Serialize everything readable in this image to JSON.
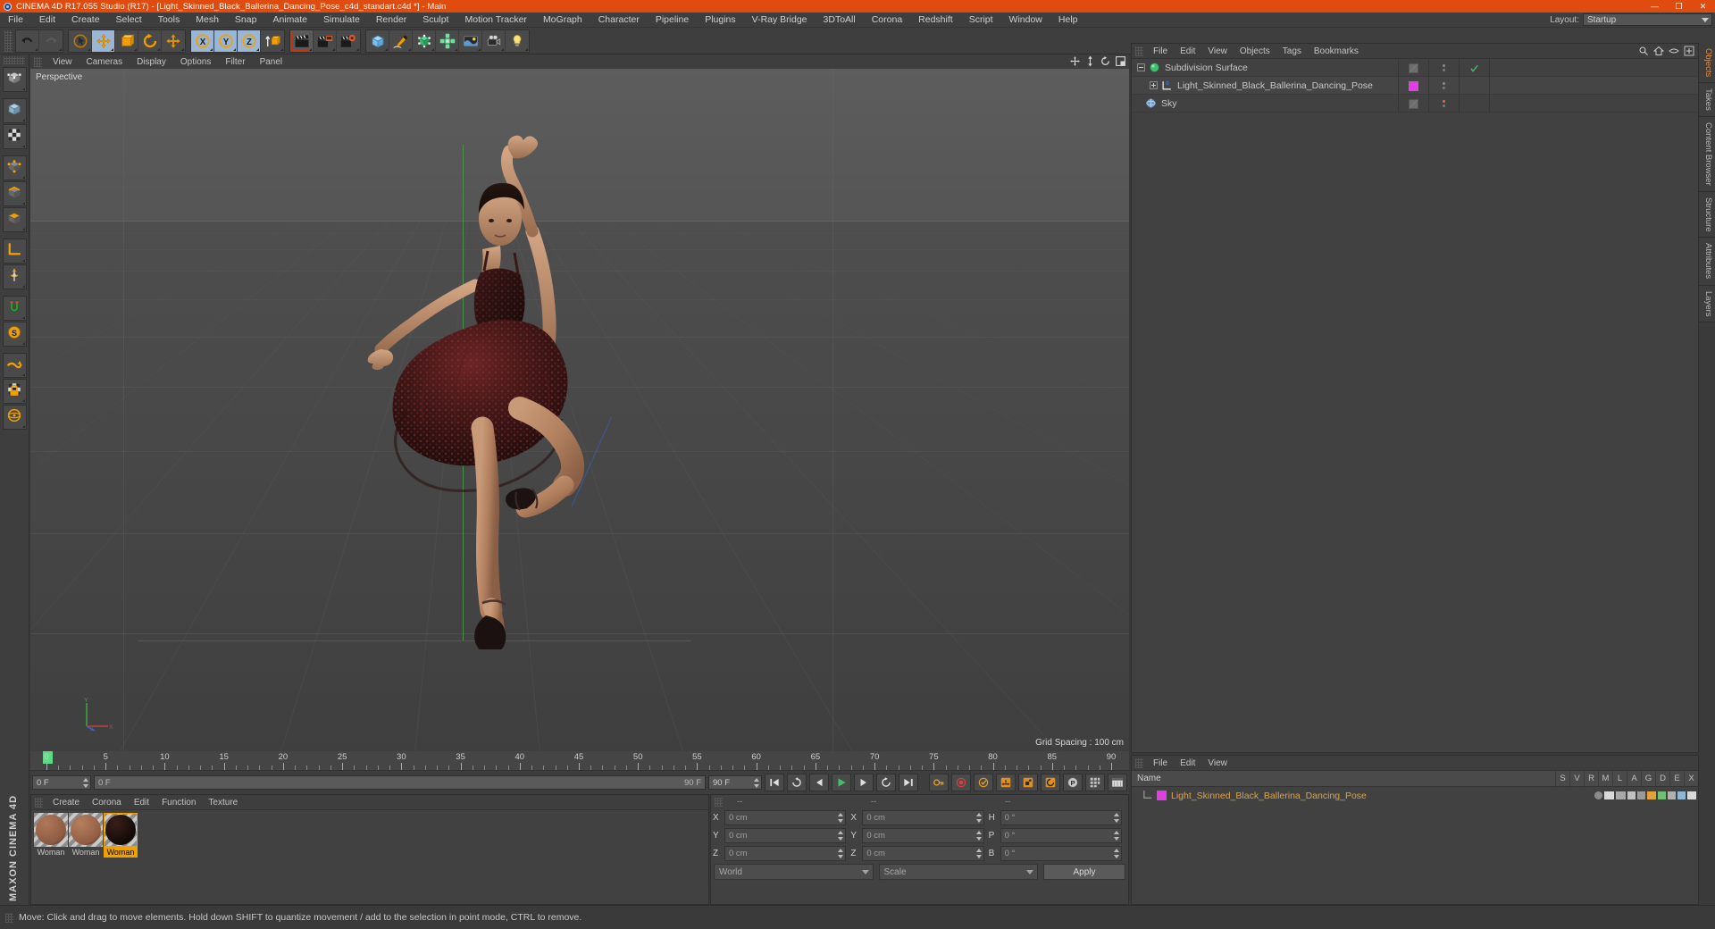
{
  "titlebar": {
    "title": "CINEMA 4D R17.055 Studio (R17) - [Light_Skinned_Black_Ballerina_Dancing_Pose_c4d_standart.c4d *] - Main",
    "minimize": "—",
    "maximize": "❐",
    "close": "✕",
    "accent": "#e04b10"
  },
  "menubar": {
    "items": [
      "File",
      "Edit",
      "Create",
      "Select",
      "Tools",
      "Mesh",
      "Snap",
      "Animate",
      "Simulate",
      "Render",
      "Sculpt",
      "Motion Tracker",
      "MoGraph",
      "Character",
      "Pipeline",
      "Plugins",
      "V-Ray Bridge",
      "3DToAll",
      "Corona",
      "Redshift",
      "Script",
      "Window",
      "Help"
    ],
    "layout_label": "Layout:",
    "layout_value": "Startup"
  },
  "toolbar": {
    "groups": [
      {
        "name": "history",
        "buttons": [
          {
            "name": "undo-button",
            "icon": "undo-icon",
            "state": "normal"
          },
          {
            "name": "redo-button",
            "icon": "redo-icon",
            "state": "disabled"
          }
        ]
      },
      {
        "name": "transform",
        "buttons": [
          {
            "name": "live-selection-tool",
            "icon": "cursor-select-icon",
            "state": "normal"
          },
          {
            "name": "move-tool",
            "icon": "move-arrows-icon",
            "state": "active"
          },
          {
            "name": "scale-tool",
            "icon": "scale-box-icon",
            "state": "normal"
          },
          {
            "name": "rotate-tool",
            "icon": "rotate-circle-icon",
            "state": "normal"
          },
          {
            "name": "free-move-tool",
            "icon": "move-arrows-icon",
            "state": "normal"
          }
        ]
      },
      {
        "name": "axis-lock",
        "buttons": [
          {
            "name": "lock-x-axis",
            "icon": "x-axis-icon",
            "state": "active"
          },
          {
            "name": "lock-y-axis",
            "icon": "y-axis-icon",
            "state": "active"
          },
          {
            "name": "lock-z-axis",
            "icon": "z-axis-icon",
            "state": "active"
          },
          {
            "name": "world-object-coordinates",
            "icon": "world-axis-icon",
            "state": "normal"
          }
        ]
      },
      {
        "name": "render",
        "buttons": [
          {
            "name": "render-view-button",
            "icon": "clapperboard-icon",
            "state": "selected"
          },
          {
            "name": "render-to-picture-viewer-button",
            "icon": "clapperboard-viewer-icon",
            "state": "normal"
          },
          {
            "name": "edit-render-settings-button",
            "icon": "clapperboard-gear-icon",
            "state": "normal"
          }
        ]
      },
      {
        "name": "create",
        "buttons": [
          {
            "name": "add-primitive-cube-button",
            "icon": "cube-icon",
            "state": "normal"
          },
          {
            "name": "add-spline-pen-button",
            "icon": "pen-spline-icon",
            "state": "normal"
          },
          {
            "name": "add-generator-nurbs-button",
            "icon": "generator-icon",
            "state": "normal"
          },
          {
            "name": "add-deformer-button",
            "icon": "deformer-icon",
            "state": "normal"
          },
          {
            "name": "add-environment-button",
            "icon": "environment-icon",
            "state": "normal"
          },
          {
            "name": "add-camera-button",
            "icon": "camera-icon",
            "state": "normal"
          },
          {
            "name": "add-light-button",
            "icon": "light-bulb-icon",
            "state": "normal"
          }
        ]
      }
    ]
  },
  "left_palette": {
    "buttons": [
      {
        "name": "make-editable-tool",
        "icon": "make-editable-icon"
      },
      {
        "name": "model-mode-tool",
        "icon": "model-mode-icon"
      },
      {
        "name": "texture-mode-tool",
        "icon": "texture-mode-icon"
      },
      {
        "name": "points-mode-tool",
        "icon": "points-mode-icon"
      },
      {
        "name": "edges-mode-tool",
        "icon": "edges-mode-icon"
      },
      {
        "name": "polygons-mode-tool",
        "icon": "polygons-mode-icon"
      },
      {
        "name": "workplane-tool",
        "icon": "workplane-icon"
      },
      {
        "name": "enable-axis-tool",
        "icon": "axis-modify-icon"
      },
      {
        "name": "enable-snapping-tool",
        "icon": "snap-magnet-icon"
      },
      {
        "name": "viewport-solo-tool",
        "icon": "viewport-solo-icon"
      },
      {
        "name": "texture-tiling-tool",
        "icon": "texture-tiling-icon"
      },
      {
        "name": "lock-workplane-tool",
        "icon": "lock-icon"
      },
      {
        "name": "workplane-mode-tool",
        "icon": "workplane-mode-icon"
      }
    ],
    "brand": "MAXON CINEMA 4D"
  },
  "viewport": {
    "menu": [
      "View",
      "Cameras",
      "Display",
      "Options",
      "Filter",
      "Panel"
    ],
    "label": "Perspective",
    "grid_spacing": "Grid Spacing : 100 cm",
    "nav_icons": [
      "pan-icon",
      "dolly-icon",
      "orbit-icon",
      "maximize-viewport-icon"
    ],
    "gizmo": {
      "x": "X",
      "y": "Y",
      "z": "Z"
    }
  },
  "object_manager": {
    "menu": [
      "File",
      "Edit",
      "View",
      "Objects",
      "Tags",
      "Bookmarks"
    ],
    "right_icons": [
      "search-icon",
      "home-icon",
      "eye-icon",
      "plus-icon"
    ],
    "rows": [
      {
        "name": "Subdivision Surface",
        "depth": 0,
        "icon": "subdivision-surface-icon",
        "icon_color": "#3fc06a",
        "expander": "minus",
        "swatch": "diag",
        "check": true,
        "dot_color": "#8a8a8a"
      },
      {
        "name": "Light_Skinned_Black_Ballerina_Dancing_Pose",
        "depth": 1,
        "icon": "null-object-icon",
        "icon_color": "#dddddd",
        "expander": "plus",
        "swatch": "magenta",
        "check": false,
        "dot_color": "#8a8a8a"
      },
      {
        "name": "Sky",
        "depth": 0,
        "icon": "sky-object-icon",
        "icon_color": "#7fa6d6",
        "expander": "none",
        "swatch": "diag",
        "check": false,
        "dot_color": "#e06060"
      }
    ]
  },
  "right_tabs": [
    {
      "label": "Objects",
      "active": true
    },
    {
      "label": "Takes",
      "active": false
    },
    {
      "label": "Content Browser",
      "active": false
    },
    {
      "label": "Structure",
      "active": false
    },
    {
      "label": "Attributes",
      "active": false
    },
    {
      "label": "Layers",
      "active": false
    }
  ],
  "timeline": {
    "ticks": [
      "0",
      "5",
      "10",
      "15",
      "20",
      "25",
      "30",
      "35",
      "40",
      "45",
      "50",
      "55",
      "60",
      "65",
      "70",
      "75",
      "80",
      "85",
      "90"
    ],
    "current_frame": "0 F",
    "start_frame": "0 F",
    "end_frame": "90 F",
    "preview_end": "90 F",
    "transport": [
      {
        "name": "go-to-start-button",
        "icon": "skip-start-icon"
      },
      {
        "name": "play-backwards-button",
        "icon": "reverse-loop-icon"
      },
      {
        "name": "step-back-button",
        "icon": "prev-frame-icon"
      },
      {
        "name": "play-button",
        "icon": "play-icon"
      },
      {
        "name": "step-forward-button",
        "icon": "next-frame-icon"
      },
      {
        "name": "loop-button",
        "icon": "loop-icon"
      },
      {
        "name": "go-to-end-button",
        "icon": "skip-end-icon"
      }
    ],
    "record_tools": [
      {
        "name": "record-active-objects-button",
        "icon": "key-icon"
      },
      {
        "name": "autokeying-button",
        "icon": "record-dot-icon"
      },
      {
        "name": "keyframe-selection-button",
        "icon": "key-selection-icon"
      },
      {
        "name": "position-key-button",
        "icon": "position-key-icon"
      },
      {
        "name": "scale-key-button",
        "icon": "scale-key-icon"
      },
      {
        "name": "rotation-key-button",
        "icon": "rotation-key-icon"
      },
      {
        "name": "parameter-key-button",
        "icon": "param-key-icon"
      },
      {
        "name": "point-level-animation-button",
        "icon": "pla-icon"
      },
      {
        "name": "timeline-toggle-button",
        "icon": "timeline-icon"
      }
    ]
  },
  "material_manager": {
    "menu": [
      "Create",
      "Corona",
      "Edit",
      "Function",
      "Texture"
    ],
    "materials": [
      {
        "label": "Woman",
        "color1": "#b0785a",
        "color2": "#8d5a40",
        "selected": false
      },
      {
        "label": "Woman",
        "color1": "#b5805f",
        "color2": "#915c42",
        "selected": false
      },
      {
        "label": "Woman",
        "color1": "#3a1f18",
        "color2": "#120a08",
        "selected": true
      }
    ]
  },
  "coordinates": {
    "headers": [
      "--",
      "--",
      "--"
    ],
    "rows": [
      {
        "l1": "X",
        "v1": "0 cm",
        "l2": "X",
        "v2": "0 cm",
        "l3": "H",
        "v3": "0 °"
      },
      {
        "l1": "Y",
        "v1": "0 cm",
        "l2": "Y",
        "v2": "0 cm",
        "l3": "P",
        "v3": "0 °"
      },
      {
        "l1": "Z",
        "v1": "0 cm",
        "l2": "Z",
        "v2": "0 cm",
        "l3": "B",
        "v3": "0 °"
      }
    ],
    "system": "World",
    "mode": "Scale",
    "apply": "Apply"
  },
  "attribute_manager": {
    "menu": [
      "File",
      "Edit",
      "View"
    ],
    "name_column": "Name",
    "columns": [
      "S",
      "V",
      "R",
      "M",
      "L",
      "A",
      "G",
      "D",
      "E",
      "X"
    ],
    "row_label": "Light_Skinned_Black_Ballerina_Dancing_Pose",
    "row_color": "#e0a33c",
    "swatch_color": "#e040e0"
  },
  "statusbar": {
    "text": "Move: Click and drag to move elements. Hold down SHIFT to quantize movement / add to the selection in point mode, CTRL to remove."
  }
}
